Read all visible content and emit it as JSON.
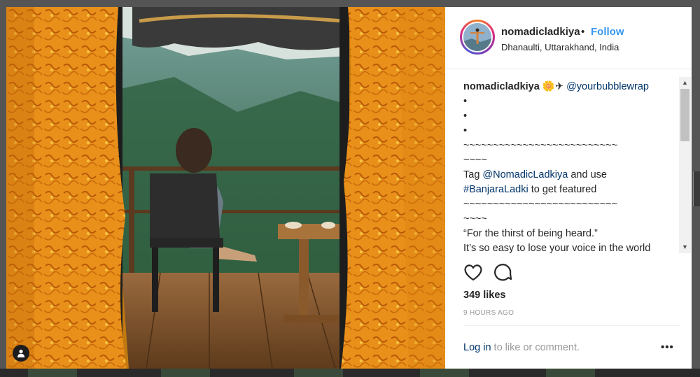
{
  "post": {
    "username": "nomadicladkiya",
    "separator": "•",
    "follow_label": "Follow",
    "location": "Dhanaulti, Uttarakhand, India",
    "caption_lines": [
      "•",
      "•",
      "•",
      "~~~~~~~~~~~~~~~~~~~~~~~~~~",
      "~~~~"
    ],
    "caption_emoji": "🌼✈",
    "caption_mention": "@yourbubblewrap",
    "tag_prefix": "Tag ",
    "tag_mention": "@NomadicLadkiya",
    "tag_middle": " and use",
    "tag_hashtag": "#BanjaraLadki",
    "tag_suffix": " to get featured",
    "divider_lines": [
      "~~~~~~~~~~~~~~~~~~~~~~~~~~",
      "~~~~"
    ],
    "quote_line1": "“For the thirst of being heard.”",
    "quote_line2": "It’s so easy to lose your voice in the world",
    "likes": "349 likes",
    "time_ago": "9 HOURS AGO",
    "login_link": "Log in",
    "login_suffix": " to like or comment.",
    "more_label": "•••"
  },
  "icons": {
    "heart": "heart-icon",
    "comment": "comment-icon",
    "tag": "user-tag-icon",
    "scroll_up": "▲",
    "scroll_down": "▼"
  },
  "colors": {
    "link": "#003569",
    "follow": "#3897f0",
    "curtain": "#e8901a"
  }
}
